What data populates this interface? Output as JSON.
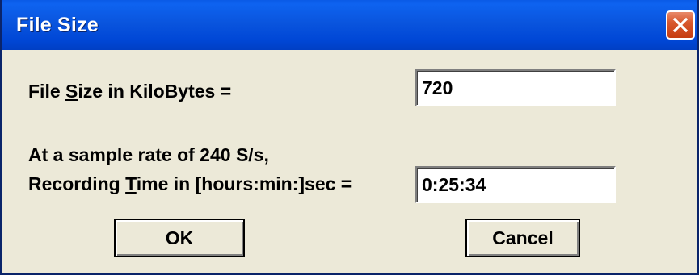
{
  "window": {
    "title": "File Size"
  },
  "file_size": {
    "label_pre": "File ",
    "label_accel": "S",
    "label_post": "ize in KiloBytes =",
    "value": "720"
  },
  "sample_rate_text": "At a sample rate of 240 S/s,",
  "recording_time": {
    "label_pre": "Recording ",
    "label_accel": "T",
    "label_post": "ime in [hours:min:]sec =",
    "value": "0:25:34"
  },
  "buttons": {
    "ok": "OK",
    "cancel": "Cancel"
  },
  "colors": {
    "titlebar": "#0a55de",
    "face": "#ece9d8",
    "close": "#d8582e"
  },
  "icons": {
    "close": "close-icon"
  }
}
